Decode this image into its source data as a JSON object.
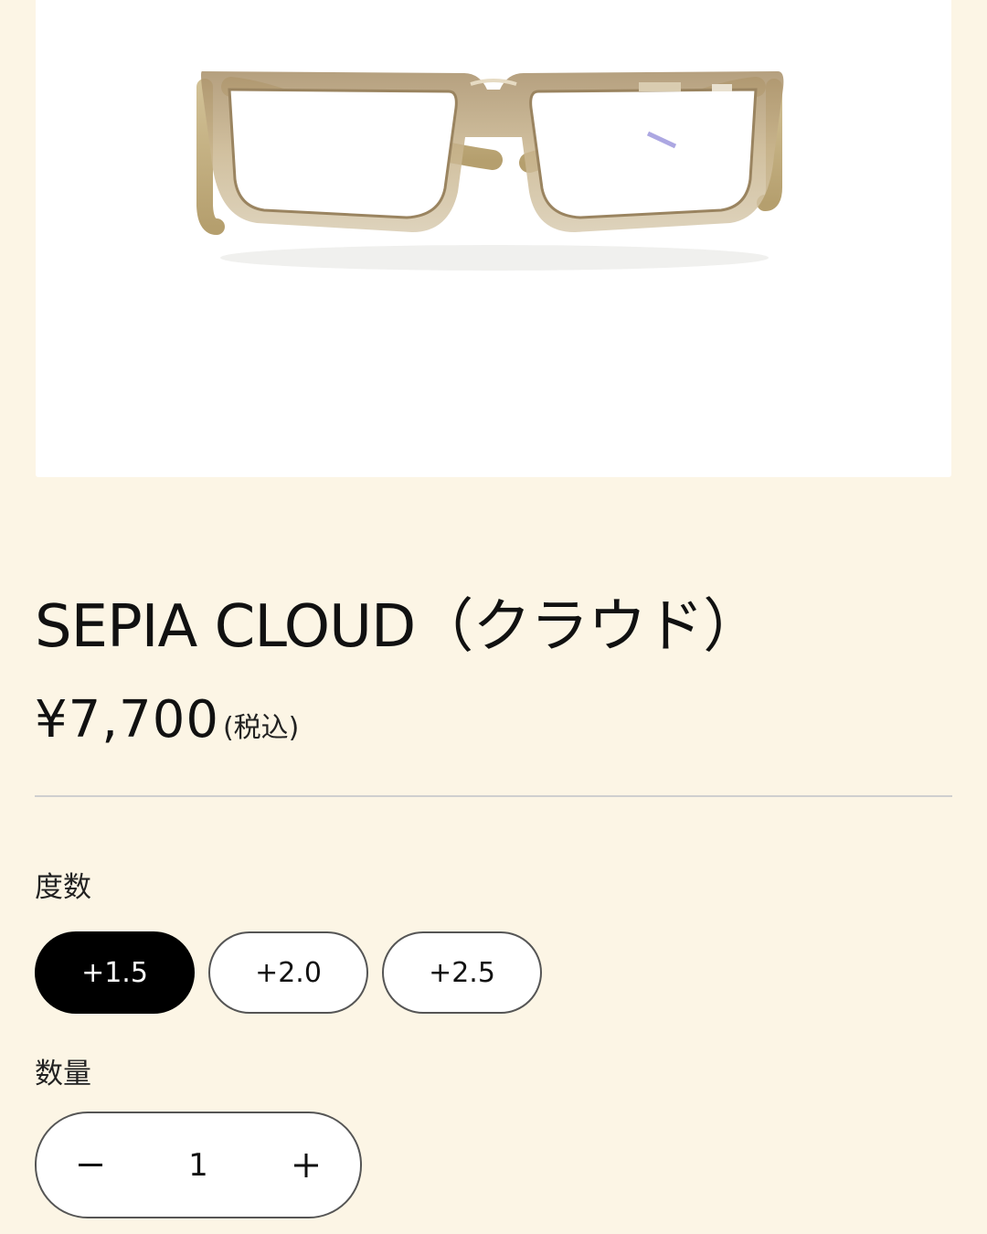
{
  "product": {
    "title": "SEPIA CLOUD（クラウド）",
    "price": "¥7,700",
    "tax_note": "(税込)",
    "image": {
      "subject": "eyeglasses",
      "frame_color": "#b9a27c",
      "temple_color": "#c7b486"
    }
  },
  "options": {
    "power_label": "度数",
    "choices": [
      "+1.5",
      "+2.0",
      "+2.5"
    ],
    "selected": "+1.5"
  },
  "quantity": {
    "label": "数量",
    "value": "1",
    "decrement_icon": "minus-icon",
    "increment_icon": "plus-icon"
  },
  "colors": {
    "page_background": "#fcf5e5",
    "selected_option_background": "#000000",
    "option_border": "#555555",
    "divider": "#cfcfcf"
  }
}
